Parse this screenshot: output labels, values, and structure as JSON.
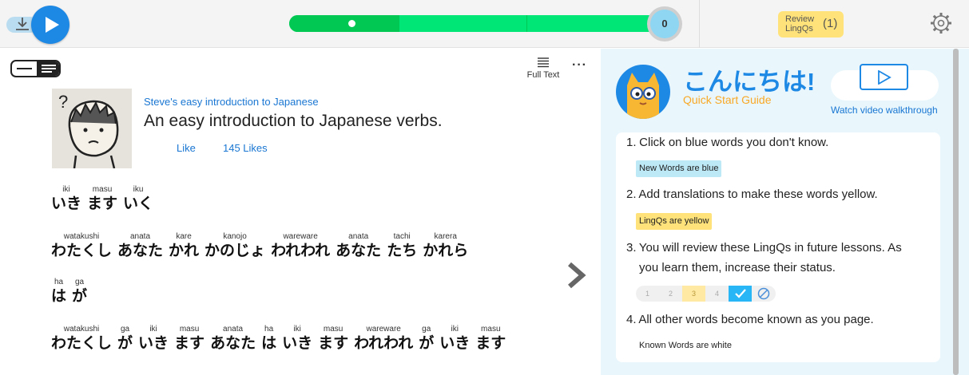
{
  "player": {
    "counter": "0",
    "progress_fraction": 0.3,
    "playhead_fraction": 0.16
  },
  "review": {
    "label_line1": "Review",
    "label_line2": "LingQs",
    "count": "(1)"
  },
  "toolbar": {
    "full_text_label": "Full Text",
    "more_label": "···"
  },
  "lesson": {
    "course": "Steve's easy introduction to Japanese",
    "title": "An easy introduction to Japanese verbs.",
    "like_label": "Like",
    "likes_count": "145 Likes"
  },
  "text_lines": [
    [
      {
        "ruby": "iki",
        "jp": "いき"
      },
      {
        "ruby": "masu",
        "jp": "ます"
      },
      {
        "ruby": "iku",
        "jp": "いく"
      }
    ],
    [
      {
        "ruby": "watakushi",
        "jp": "わたくし"
      },
      {
        "ruby": "anata",
        "jp": "あなた"
      },
      {
        "ruby": "kare",
        "jp": "かれ"
      },
      {
        "ruby": "kanojo",
        "jp": "かのじょ"
      },
      {
        "ruby": "wareware",
        "jp": "われわれ"
      },
      {
        "ruby": "anata",
        "jp": "あなた"
      },
      {
        "ruby": "tachi",
        "jp": "たち"
      },
      {
        "ruby": "karera",
        "jp": "かれら"
      }
    ],
    [
      {
        "ruby": "ha",
        "jp": "は"
      },
      {
        "ruby": "ga",
        "jp": "が"
      }
    ],
    [
      {
        "ruby": "watakushi",
        "jp": "わたくし"
      },
      {
        "ruby": "ga",
        "jp": "が"
      },
      {
        "ruby": "iki",
        "jp": "いき"
      },
      {
        "ruby": "masu",
        "jp": "ます"
      },
      {
        "ruby": "anata",
        "jp": "あなた"
      },
      {
        "ruby": "ha",
        "jp": "は"
      },
      {
        "ruby": "iki",
        "jp": "いき"
      },
      {
        "ruby": "masu",
        "jp": "ます"
      },
      {
        "ruby": "wareware",
        "jp": "われわれ"
      },
      {
        "ruby": "ga",
        "jp": "が"
      },
      {
        "ruby": "iki",
        "jp": "いき"
      },
      {
        "ruby": "masu",
        "jp": "ます"
      }
    ]
  ],
  "guide": {
    "greeting": "こんにちは!",
    "subtitle": "Quick Start Guide",
    "video_label": "Watch video walkthrough",
    "steps": [
      {
        "num": "1.",
        "line1": "Click on blue words you don't know.",
        "line2": ""
      },
      {
        "num": "2.",
        "line1": "Add translations to make these words yellow.",
        "line2": ""
      },
      {
        "num": "3.",
        "line1": "You will review these LingQs in future lessons. As",
        "line2": "you learn them, increase their status."
      },
      {
        "num": "4.",
        "line1": "All other words become known as you page.",
        "line2": ""
      }
    ],
    "badges": {
      "new": "New Words are blue",
      "lingq": "LingQs are yellow",
      "known": "Known Words are white"
    },
    "statuses": [
      "1",
      "2",
      "3",
      "4"
    ]
  },
  "colors": {
    "accent": "#1e88e5",
    "progress": "#00e676",
    "lingq_yellow": "#ffe37a",
    "new_blue": "#bde9f7",
    "panel_bg": "#e9f7fd"
  }
}
